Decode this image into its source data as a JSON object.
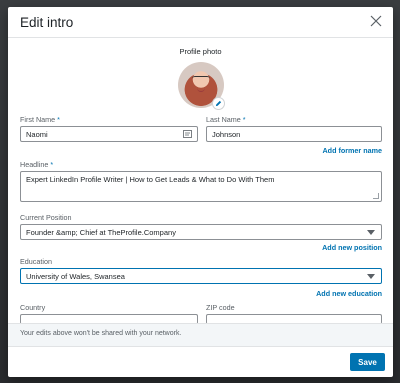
{
  "modal": {
    "title": "Edit intro",
    "photo_label": "Profile photo"
  },
  "form": {
    "first_name": {
      "label": "First Name",
      "required": "*",
      "value": "Naomi"
    },
    "last_name": {
      "label": "Last Name",
      "required": "*",
      "value": "Johnson"
    },
    "add_former_name": "Add former name",
    "headline": {
      "label": "Headline",
      "required": "*",
      "value": "Expert LinkedIn Profile Writer  | How to Get Leads & What to Do With Them"
    },
    "current_position": {
      "label": "Current Position",
      "value": "Founder &amp; Chief at TheProfile.Company"
    },
    "add_new_position": "Add new position",
    "education": {
      "label": "Education",
      "value": "University of Wales, Swansea"
    },
    "add_new_education": "Add new education",
    "country": {
      "label": "Country"
    },
    "zip": {
      "label": "ZIP code"
    }
  },
  "note": "Your edits above won't be shared with your network.",
  "footer": {
    "save_label": "Save"
  },
  "colors": {
    "accent": "#0073b1",
    "note_bg": "#f3f6f8"
  },
  "icons": [
    "close-icon",
    "pencil-icon",
    "contact-card-icon",
    "caret-down-icon"
  ]
}
